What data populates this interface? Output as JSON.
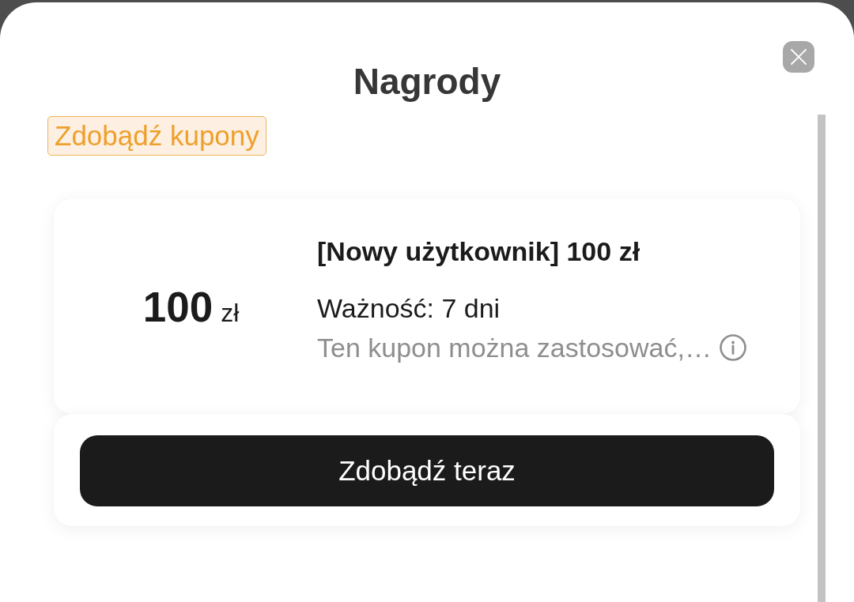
{
  "sheet": {
    "title": "Nagrody"
  },
  "tag": "Zdobądź kupony",
  "coupons": [
    {
      "amount": "100",
      "currency": "zł",
      "title": "[Nowy użytkownik] 100 zł",
      "validity": "Ważność: 7 dni",
      "description": "Ten kupon można zastosować,…"
    }
  ],
  "action_button": "Zdobądź teraz"
}
